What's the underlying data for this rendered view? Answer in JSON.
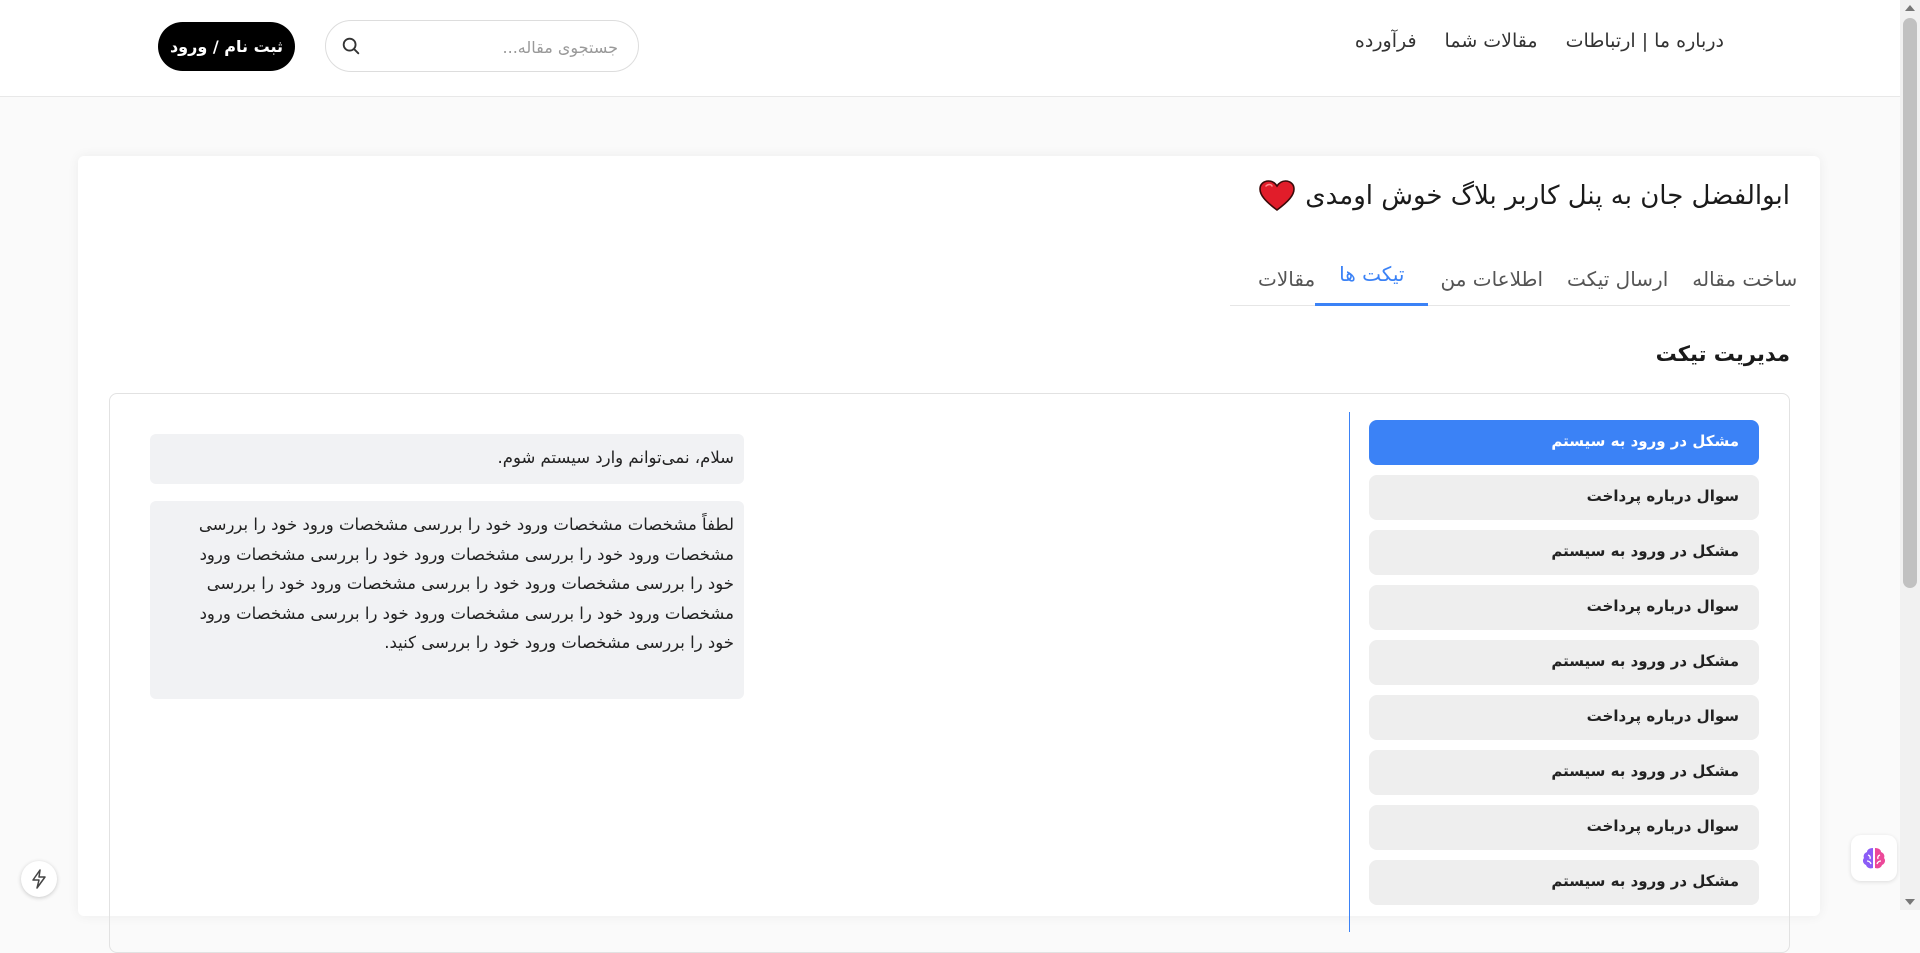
{
  "header": {
    "nav": [
      {
        "label": "فرآورده"
      },
      {
        "label": "مقالات شما"
      },
      {
        "label": "درباره ما | ارتباطات"
      }
    ],
    "search": {
      "placeholder": "جستجوی مقاله...",
      "value": "",
      "icon": "search-icon"
    },
    "login_label": "ثبت نام / ورود"
  },
  "dashboard": {
    "welcome": "ابوالفضل جان به پنل کاربر بلاگ خوش اومدی",
    "welcome_icon": "heart-icon",
    "tabs": [
      {
        "label": "مقالات",
        "active": false
      },
      {
        "label": "تیکت ها",
        "active": true
      },
      {
        "label": "اطلاعات من",
        "active": false
      },
      {
        "label": "ارسال تیکت",
        "active": false
      },
      {
        "label": "ساخت مقاله",
        "active": false
      }
    ],
    "section_title": "مدیریت تیکت",
    "tickets": [
      {
        "label": "مشکل در ورود به سیستم",
        "active": true
      },
      {
        "label": "سوال درباره پرداخت",
        "active": false
      },
      {
        "label": "مشکل در ورود به سیستم",
        "active": false
      },
      {
        "label": "سوال درباره پرداخت",
        "active": false
      },
      {
        "label": "مشکل در ورود به سیستم",
        "active": false
      },
      {
        "label": "سوال درباره پرداخت",
        "active": false
      },
      {
        "label": "مشکل در ورود به سیستم",
        "active": false
      },
      {
        "label": "سوال درباره پرداخت",
        "active": false
      },
      {
        "label": "مشکل در ورود به سیستم",
        "active": false
      }
    ],
    "messages": [
      {
        "text": "سلام، نمی‌توانم وارد سیستم شوم."
      },
      {
        "text": "لطفاً مشخصات مشخصات ورود خود را بررسی مشخصات ورود خود را بررسی مشخصات ورود خود را بررسی مشخصات ورود خود را بررسی مشخصات ورود خود را بررسی مشخصات ورود خود را بررسی مشخصات ورود خود را بررسی مشخصات ورود خود را بررسی مشخصات ورود خود را بررسی مشخصات ورود خود را بررسی مشخصات ورود خود را بررسی کنید."
      }
    ]
  },
  "colors": {
    "accent": "#3b82f6",
    "login_bg": "#000000",
    "card_bg": "#ffffff",
    "page_bg": "#fafafa"
  },
  "floating": {
    "left_icon": "lightning-icon",
    "right_icon": "brain-icon"
  }
}
